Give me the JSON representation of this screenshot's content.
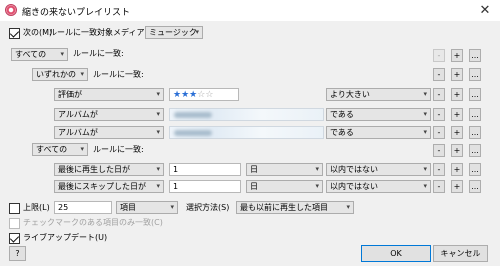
{
  "window": {
    "title": "縮きの来ないプレイリスト",
    "close_glyph": "✕"
  },
  "top": {
    "match_label": "次の(M)",
    "rule_label": "ルールに一致:",
    "media_label": "対象メディア:",
    "media_value": "ミュージック",
    "match_checked": true
  },
  "groups": {
    "g1_select": "すべての",
    "g1_label": "ルールに一致:",
    "g2_select": "いずれかの",
    "g2_label": "ルールに一致:",
    "g3_select": "すべての",
    "g3_label": "ルールに一致:"
  },
  "rules": [
    {
      "field": "評価が",
      "rating": 3,
      "rating_max": 5,
      "op": "より大きい"
    },
    {
      "field": "アルバムが",
      "value_blurred": true,
      "op": "である"
    },
    {
      "field": "アルバムが",
      "value_blurred": true,
      "op": "である"
    },
    {
      "field": "最後に再生した日が",
      "value": "1",
      "unit": "日",
      "op": "以内ではない"
    },
    {
      "field": "最後にスキップした日が",
      "value": "1",
      "unit": "日",
      "op": "以内ではない"
    }
  ],
  "buttons": {
    "minus": "-",
    "plus": "+",
    "more": "..."
  },
  "limit": {
    "label": "上限(L)",
    "value": "25",
    "unit": "項目",
    "method_label": "選択方法(S)",
    "method_value": "最も以前に再生した項目",
    "checked": false
  },
  "checked_only": {
    "label": "チェックマークのある項目のみ一致(C)",
    "checked": false
  },
  "live_update": {
    "label": "ライブアップデート(U)",
    "checked": true
  },
  "footer": {
    "help": "?",
    "ok": "OK",
    "cancel": "キャンセル"
  }
}
